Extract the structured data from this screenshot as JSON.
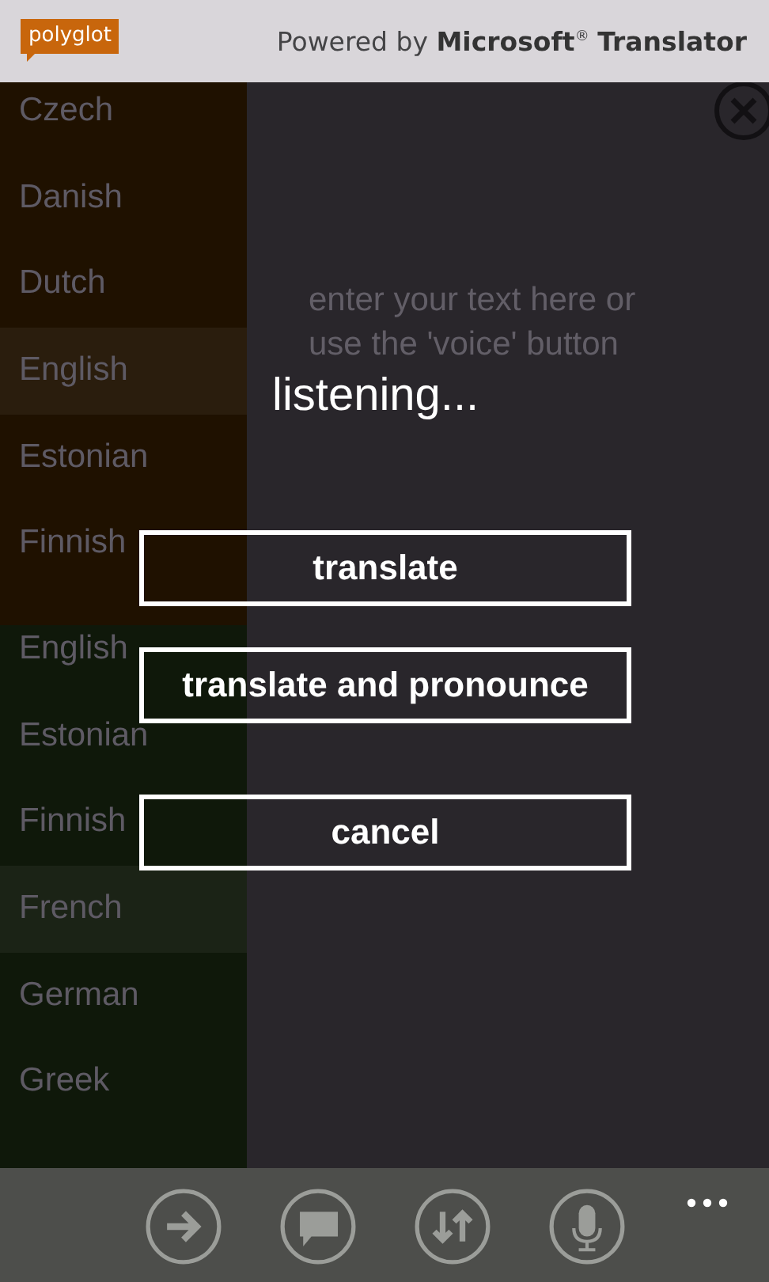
{
  "header": {
    "logo": "polyglot",
    "credit": "Powered by **Microsoft**$^{®}$ **Translator**"
  },
  "source_languages": [
    {
      "label": "Czech",
      "selected": false
    },
    {
      "label": "Danish",
      "selected": false
    },
    {
      "label": "Dutch",
      "selected": false
    },
    {
      "label": "English",
      "selected": true
    },
    {
      "label": "Estonian",
      "selected": false
    },
    {
      "label": "Finnish",
      "selected": false
    }
  ],
  "target_languages": [
    {
      "label": "English",
      "selected": false
    },
    {
      "label": "Estonian",
      "selected": false
    },
    {
      "label": "Finnish",
      "selected": false
    },
    {
      "label": "French",
      "selected": true
    },
    {
      "label": "German",
      "selected": false
    },
    {
      "label": "Greek",
      "selected": false
    }
  ],
  "input": {
    "placeholder": "enter your text here or use the 'voice' button"
  },
  "dialog": {
    "title": "listening...",
    "buttons": [
      "translate",
      "translate and pronounce",
      "cancel"
    ]
  },
  "app_bar": {
    "buttons": [
      {
        "kind": "arrow"
      },
      {
        "kind": "message"
      },
      {
        "kind": "swap"
      },
      {
        "kind": "microphone"
      }
    ]
  }
}
